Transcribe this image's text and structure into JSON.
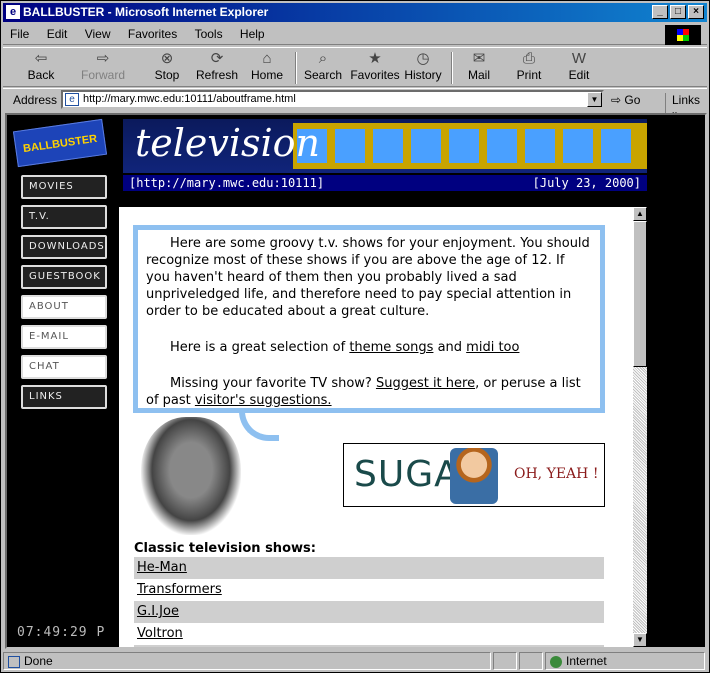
{
  "window": {
    "title": "BALLBUSTER - Microsoft Internet Explorer",
    "controls": [
      "_",
      "□",
      "×"
    ]
  },
  "menu": [
    "File",
    "Edit",
    "View",
    "Favorites",
    "Tools",
    "Help"
  ],
  "toolbar": {
    "back": "Back",
    "forward": "Forward",
    "stop": "Stop",
    "refresh": "Refresh",
    "home": "Home",
    "search": "Search",
    "favorites": "Favorites",
    "history": "History",
    "mail": "Mail",
    "print": "Print",
    "edit": "Edit"
  },
  "address": {
    "label": "Address",
    "url": "http://mary.mwc.edu:10111/aboutframe.html",
    "go": "Go",
    "links": "Links"
  },
  "site": {
    "logo": "BALLBUSTER",
    "nav": [
      "MOVIES",
      "T.V.",
      "DOWNLOADS",
      "GUESTBOOK",
      "ABOUT",
      "E-MAIL",
      "CHAT",
      "LINKS"
    ],
    "clock": "07:49:29 P",
    "banner_title": "television",
    "info_url": "[http://mary.mwc.edu:10111]",
    "info_date": "[July 23, 2000]"
  },
  "content": {
    "intro_p1": "Here are some groovy t.v. shows for your enjoyment. You should recognize most of these shows if you are above the age of 12. If you haven't heard of them then you probably lived a sad unpriveledged life, and therefore need to pay special attention in order to be educated about a great culture.",
    "p2_prefix": "Here is a great selection of ",
    "theme_songs": "theme songs",
    "p2_and": " and ",
    "midi_too": "midi too",
    "p3_prefix": "Missing your favorite TV show? ",
    "suggest": "Suggest it here",
    "p3_mid": ", or peruse a list of past ",
    "visitor_suggestions": "visitor's suggestions.",
    "ad_sugar": "SUGAR",
    "ad_yeah": "OH, YEAH !",
    "heading": "Classic television shows:",
    "shows": [
      "He-Man",
      "Transformers",
      "G.I.Joe",
      "Voltron"
    ]
  },
  "status": {
    "text": "Done",
    "zone": "Internet"
  }
}
